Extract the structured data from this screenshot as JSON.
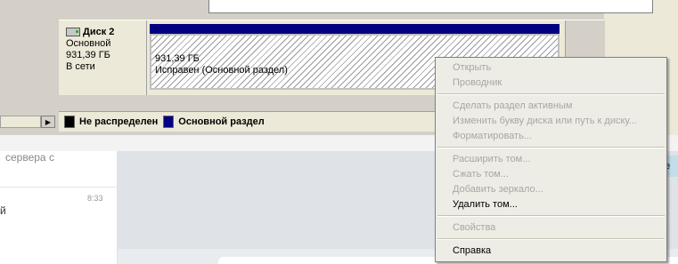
{
  "disk": {
    "name": "Диск 2",
    "type": "Основной",
    "size": "931,39 ГБ",
    "state": "В сети"
  },
  "partition": {
    "size": "931,39 ГБ",
    "status": "Исправен (Основной раздел)"
  },
  "legend": {
    "unallocated_label": "Не распределен",
    "unallocated_color": "#000000",
    "primary_label": "Основной раздел",
    "primary_color": "#000080"
  },
  "context_menu": {
    "items": [
      {
        "label": "Открыть",
        "enabled": false
      },
      {
        "label": "Проводник",
        "enabled": false
      },
      {
        "label": "Сделать раздел активным",
        "enabled": false
      },
      {
        "label": "Изменить букву диска или путь к диску...",
        "enabled": false
      },
      {
        "label": "Форматировать...",
        "enabled": false
      },
      {
        "label": "Расширить том...",
        "enabled": false
      },
      {
        "label": "Сжать том...",
        "enabled": false
      },
      {
        "label": "Добавить зеркало...",
        "enabled": false
      },
      {
        "label": "Удалить том...",
        "enabled": true
      },
      {
        "label": "Свойства",
        "enabled": false
      },
      {
        "label": "Справка",
        "enabled": true
      }
    ]
  },
  "background_app": {
    "preview_text": "сервера с",
    "time": "8:33",
    "letter": "й",
    "teal_text": "не"
  }
}
